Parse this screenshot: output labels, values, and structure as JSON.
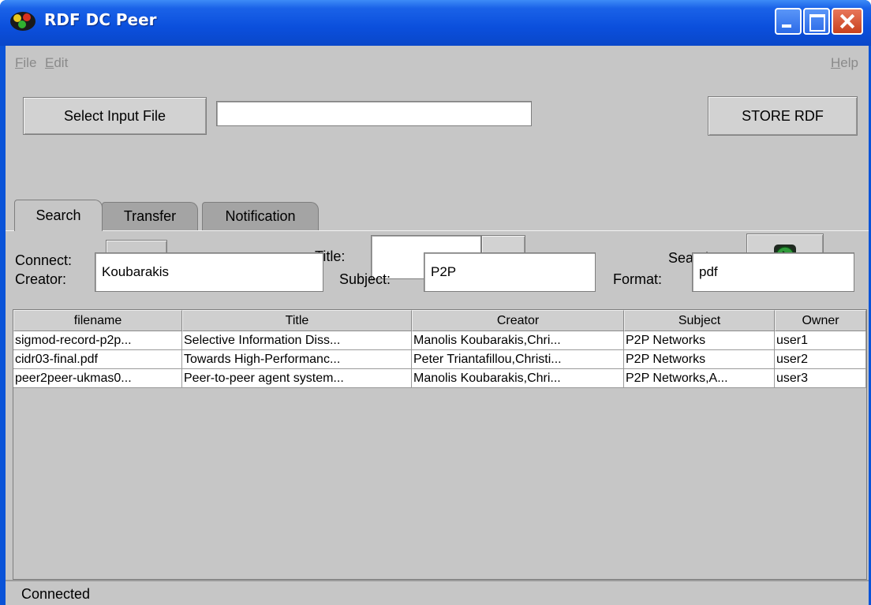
{
  "window": {
    "title": "RDF DC Peer"
  },
  "menubar": {
    "file": "File",
    "edit": "Edit",
    "help": "Help"
  },
  "toolbar": {
    "select_input_label": "Select Input File",
    "input_file_value": "",
    "store_rdf_label": "STORE RDF"
  },
  "tabs": [
    {
      "label": "Search",
      "active": true
    },
    {
      "label": "Transfer",
      "active": false
    },
    {
      "label": "Notification",
      "active": false
    }
  ],
  "search": {
    "connect_label": "Connect:",
    "title_label": "Title:",
    "title_value": "",
    "search_label": "Search:",
    "creator_label": "Creator:",
    "creator_value": "Koubarakis",
    "subject_label": "Subject:",
    "subject_value": "P2P",
    "format_label": "Format:",
    "format_value": "pdf"
  },
  "table": {
    "columns": [
      "filename",
      "Title",
      "Creator",
      "Subject",
      "Owner"
    ],
    "rows": [
      [
        "sigmod-record-p2p...",
        "Selective Information Diss...",
        "Manolis Koubarakis,Chri...",
        "P2P Networks",
        "user1"
      ],
      [
        "cidr03-final.pdf",
        "Towards High-Performanc...",
        "Peter Triantafillou,Christi...",
        "P2P Networks",
        "user2"
      ],
      [
        "peer2peer-ukmas0...",
        "Peer-to-peer agent system...",
        "Manolis Koubarakis,Chri...",
        "P2P Networks,A...",
        "user3"
      ]
    ]
  },
  "status": {
    "text": "Connected"
  },
  "colors": {
    "titlebar": "#0b4fdc",
    "client_bg": "#c6c6c6",
    "close_button": "#c8421e"
  },
  "icons": [
    "app-icon",
    "minimize-icon",
    "maximize-icon",
    "close-icon",
    "play-icon",
    "chevron-down-icon",
    "search-globe-icon"
  ]
}
